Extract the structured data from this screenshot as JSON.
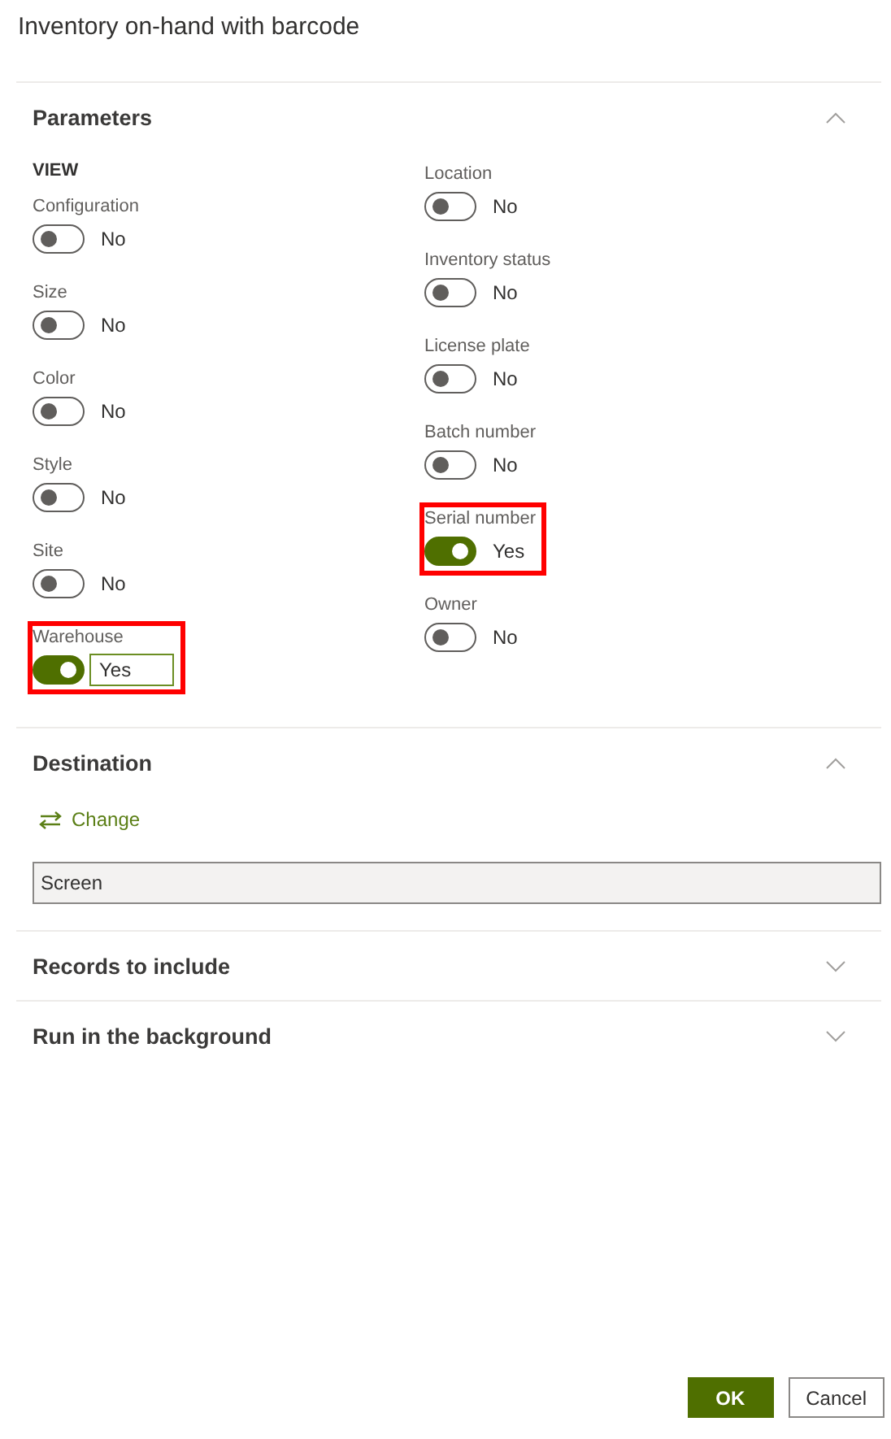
{
  "dialog": {
    "title": "Inventory on-hand with barcode"
  },
  "sections": [
    {
      "kind": "parameters",
      "title": "Parameters",
      "expanded": true,
      "group_label": "VIEW",
      "columns": [
        [
          {
            "label": "Configuration",
            "on": false,
            "value": "No",
            "highlighted": false,
            "boxed": false
          },
          {
            "label": "Size",
            "on": false,
            "value": "No",
            "highlighted": false,
            "boxed": false
          },
          {
            "label": "Color",
            "on": false,
            "value": "No",
            "highlighted": false,
            "boxed": false
          },
          {
            "label": "Style",
            "on": false,
            "value": "No",
            "highlighted": false,
            "boxed": false
          },
          {
            "label": "Site",
            "on": false,
            "value": "No",
            "highlighted": false,
            "boxed": false
          },
          {
            "label": "Warehouse",
            "on": true,
            "value": "Yes",
            "highlighted": true,
            "boxed": true
          }
        ],
        [
          {
            "label": "Location",
            "on": false,
            "value": "No",
            "highlighted": false,
            "boxed": false
          },
          {
            "label": "Inventory status",
            "on": false,
            "value": "No",
            "highlighted": false,
            "boxed": false
          },
          {
            "label": "License plate",
            "on": false,
            "value": "No",
            "highlighted": false,
            "boxed": false
          },
          {
            "label": "Batch number",
            "on": false,
            "value": "No",
            "highlighted": false,
            "boxed": false
          },
          {
            "label": "Serial number",
            "on": true,
            "value": "Yes",
            "highlighted": true,
            "boxed": false
          },
          {
            "label": "Owner",
            "on": false,
            "value": "No",
            "highlighted": false,
            "boxed": false
          }
        ]
      ]
    },
    {
      "kind": "destination",
      "title": "Destination",
      "expanded": true,
      "change_link": "Change",
      "value": "Screen"
    },
    {
      "title": "Records to include",
      "expanded": false
    },
    {
      "title": "Run in the background",
      "expanded": false
    }
  ],
  "buttons": [
    {
      "label": "OK",
      "kind": "primary"
    },
    {
      "label": "Cancel",
      "kind": "secondary"
    }
  ]
}
